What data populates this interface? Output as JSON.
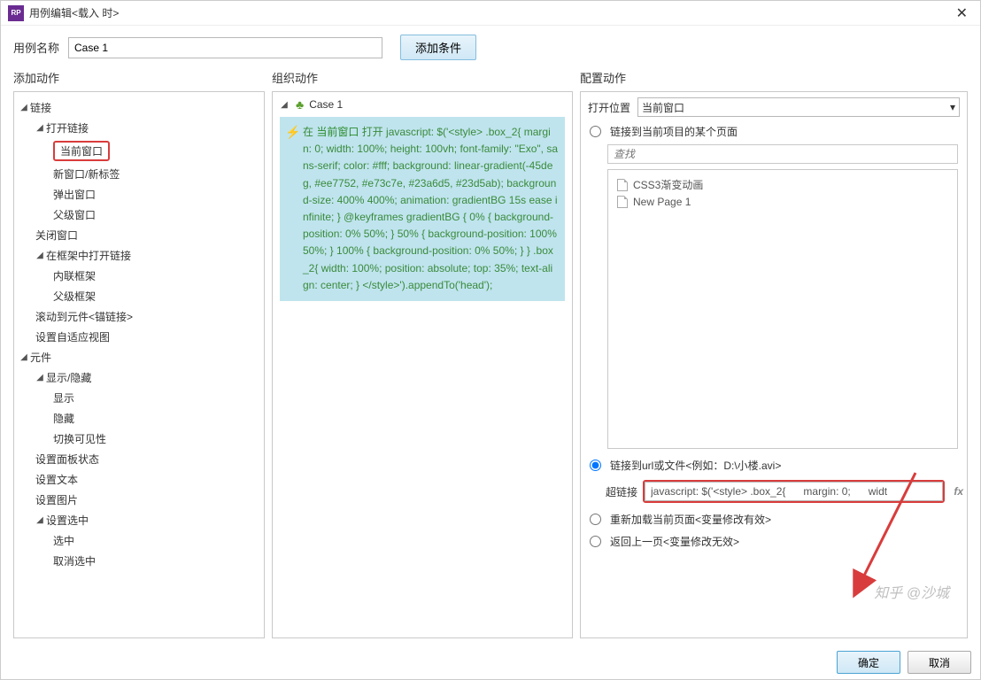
{
  "titlebar": {
    "title": "用例编辑<载入 时>"
  },
  "top": {
    "case_label": "用例名称",
    "case_value": "Case 1",
    "add_condition": "添加条件"
  },
  "columns": {
    "left_title": "添加动作",
    "mid_title": "组织动作",
    "right_title": "配置动作"
  },
  "tree": {
    "links": "链接",
    "open_link": "打开链接",
    "current_window": "当前窗口",
    "new_window": "新窗口/新标签",
    "popup_window": "弹出窗口",
    "parent_window": "父级窗口",
    "close_window": "关闭窗口",
    "open_in_frame": "在框架中打开链接",
    "inline_frame": "内联框架",
    "parent_frame": "父级框架",
    "scroll_anchor": "滚动到元件<锚链接>",
    "adaptive_view": "设置自适应视图",
    "widgets": "元件",
    "show_hide": "显示/隐藏",
    "show": "显示",
    "hide": "隐藏",
    "toggle_vis": "切换可见性",
    "panel_state": "设置面板状态",
    "set_text": "设置文本",
    "set_image": "设置图片",
    "set_selected": "设置选中",
    "selected": "选中",
    "more": "取消选中"
  },
  "org": {
    "case_name": "Case 1",
    "prefix": "在 ",
    "target": "当前窗口",
    "verb": " 打开 ",
    "script": "javascript: $('<style> .box_2{      margin: 0;      width: 100%;      height: 100vh;      font-family: \"Exo\", sans-serif;      color: #fff;      background: linear-gradient(-45deg, #ee7752, #e73c7e, #23a6d5, #23d5ab);      background-size: 400% 400%;      animation: gradientBG 15s ease infinite; } @keyframes gradientBG {       0% {           background-position: 0% 50%;     }     50% {           background-position: 100% 50%;     }     100% {           background-position: 0% 50%;     } } .box_2{      width: 100%;      position: absolute;      top: 35%;      text-align: center; } </style>').appendTo('head');"
  },
  "config": {
    "open_in_label": "打开位置",
    "open_in_value": "当前窗口",
    "radio_link_page": "链接到当前项目的某个页面",
    "search_placeholder": "查找",
    "pages": [
      "CSS3渐变动画",
      "New Page 1"
    ],
    "radio_link_url": "链接到url或文件<例如：D:\\小楼.avi>",
    "url_label": "超链接",
    "url_value": "javascript: $('<style> .box_2{      margin: 0;      widt",
    "fx_label": "fx",
    "radio_reload": "重新加载当前页面<变量修改有效>",
    "radio_back": "返回上一页<变量修改无效>"
  },
  "footer": {
    "ok": "确定",
    "cancel": "取消"
  },
  "watermark": "知乎 @沙城"
}
